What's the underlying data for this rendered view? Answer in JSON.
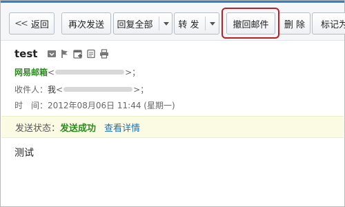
{
  "toolbar": {
    "back_label": "返回",
    "resend_label": "再次发送",
    "reply_all_label": "回复全部",
    "forward_label": "转 发",
    "recall_label": "撤回邮件",
    "delete_label": "删 除",
    "mark_label": "标记为"
  },
  "mail": {
    "subject": "test",
    "sender_name": "网易邮箱",
    "sender_open": "<",
    "sender_close": ">；",
    "recipient_label": "收件人：",
    "recipient_name": "我",
    "recipient_open": "<",
    "recipient_close": ">；",
    "time_label": "时　间：",
    "time_value": "2012年08月06日 11:44 (星期一)",
    "body": "测试"
  },
  "status": {
    "label": "发送状态：",
    "value": "发送成功",
    "details_link": "查看详情"
  },
  "colors": {
    "accent_blue": "#2f82c4",
    "sender_green": "#2b8a1e",
    "highlight_red": "#b51f25",
    "status_bg": "#fbfbe3",
    "link_blue": "#1f6fb9"
  },
  "icons": [
    "chevron-back-icon",
    "dropdown-caret-icon",
    "move-icon",
    "flag-icon",
    "calendar-add-icon",
    "note-icon",
    "print-icon"
  ]
}
